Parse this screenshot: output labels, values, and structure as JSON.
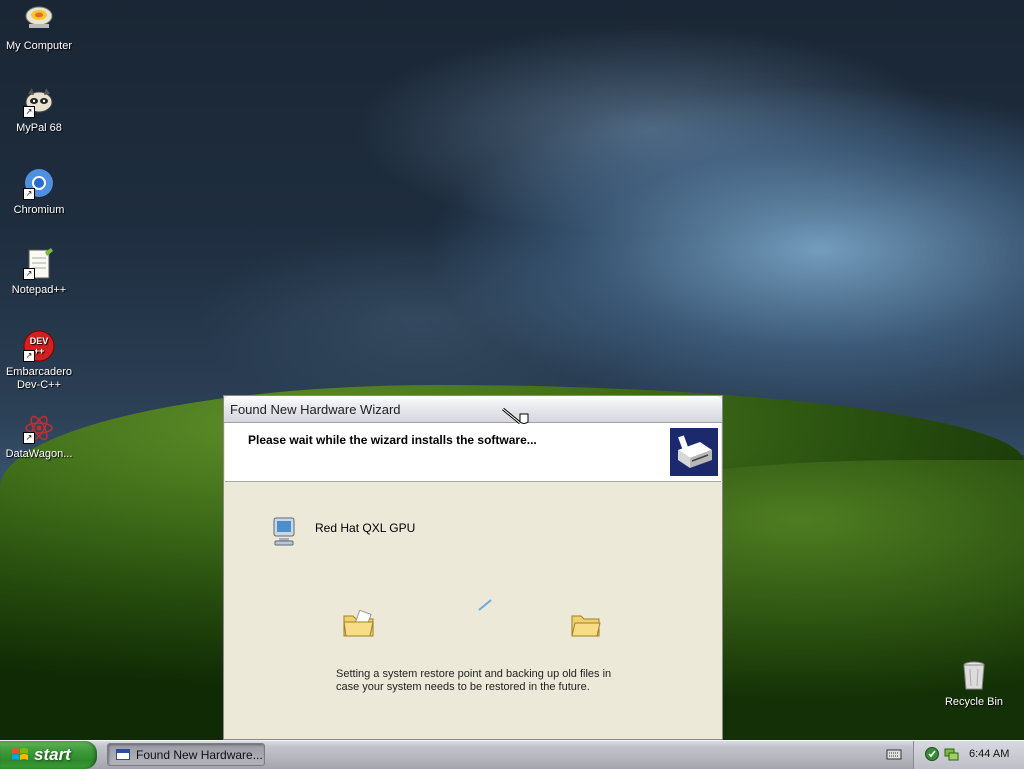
{
  "desktop": {
    "icons": [
      {
        "label": "My Computer"
      },
      {
        "label": "MyPal 68"
      },
      {
        "label": "Chromium"
      },
      {
        "label": "Notepad++"
      },
      {
        "label_line1": "Embarcadero",
        "label_line2": "Dev-C++",
        "badge": "DEV++"
      },
      {
        "label": "DataWagon..."
      },
      {
        "label": "Recycle Bin"
      }
    ]
  },
  "wizard": {
    "title": "Found New Hardware Wizard",
    "header_text": "Please wait while the wizard installs the software...",
    "device_name": "Red Hat QXL GPU",
    "status_line1": "Setting a system restore point and backing up old files in",
    "status_line2": "case your system needs to be restored in the future."
  },
  "taskbar": {
    "start_label": "start",
    "task_button_label": "Found New Hardware...",
    "clock": "6:44 AM"
  },
  "colors": {
    "start_green": "#3e9a3a",
    "wizard_header_icon_bg": "#1a2a6c",
    "window_bg": "#ece9d8"
  }
}
